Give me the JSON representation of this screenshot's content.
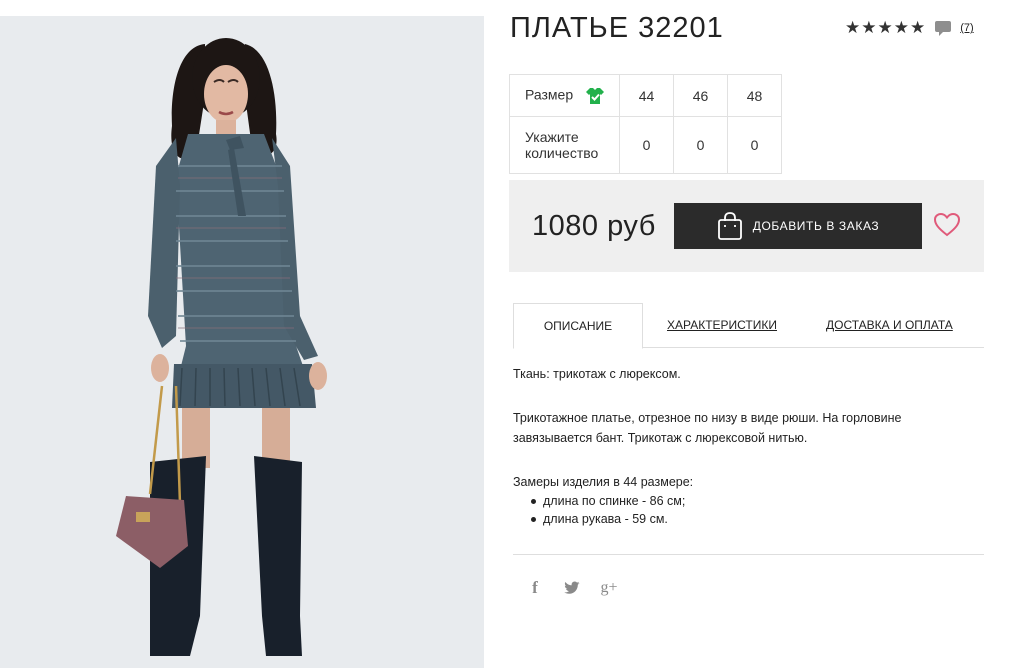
{
  "product": {
    "title": "ПЛАТЬЕ 32201",
    "rating_stars": "★★★★★",
    "review_count": "(7)"
  },
  "sizes": {
    "size_label": "Размер",
    "qty_label_1": "Укажите",
    "qty_label_2": "количество",
    "values": [
      "44",
      "46",
      "48"
    ],
    "quantities": [
      "0",
      "0",
      "0"
    ]
  },
  "buy": {
    "price": "1080 руб",
    "add_button": "ДОБАВИТЬ В ЗАКАЗ"
  },
  "tabs": {
    "description": "ОПИСАНИЕ",
    "specs": "ХАРАКТЕРИСТИКИ",
    "delivery": "ДОСТАВКА И ОПЛАТА"
  },
  "description": {
    "fabric": "Ткань: трикотаж с люрексом.",
    "text": "Трикотажное платье, отрезное по низу в виде рюши. На горловине завязывается бант. Трикотаж с люрексовой нитью.",
    "measure_title": "Замеры изделия в 44 размере:",
    "measures": [
      "длина по спинке - 86 см;",
      "длина рукава - 59 см."
    ]
  },
  "social": {
    "facebook": "f",
    "twitter": "twitter-icon",
    "google": "g+"
  },
  "colors": {
    "button_bg": "#2b2b2b",
    "buybox_bg": "#efefef",
    "size_icon": "#22b14c",
    "heart": "#e05a7a"
  }
}
